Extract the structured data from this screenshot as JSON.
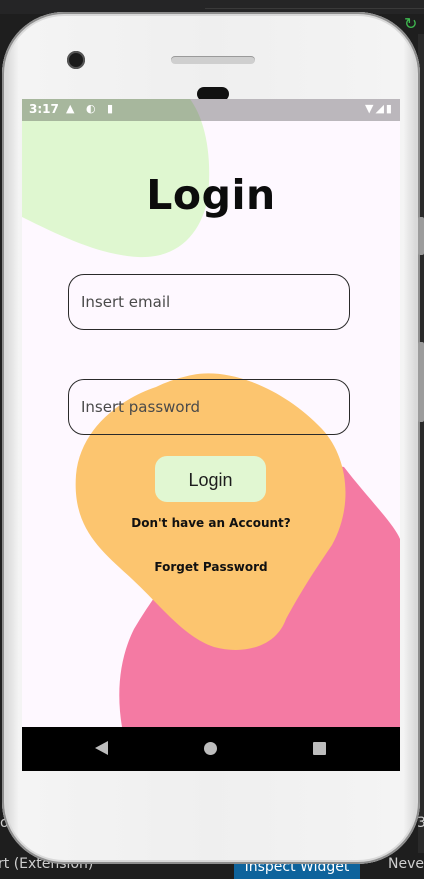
{
  "ide": {
    "extension_label": "rt (Extension)",
    "inspect_label": "Inspect Widget",
    "never_label": "Never",
    "left_fragment": "o",
    "right_fragment": "3",
    "refresh_icon": "refresh-icon"
  },
  "device": {
    "status_bar": {
      "time": "3:17",
      "left_icons": "▲ ◐ ▮",
      "right_icons": "▼◢▮"
    }
  },
  "login": {
    "title": "Login",
    "email_placeholder": "Insert email",
    "password_placeholder": "Insert password",
    "login_button": "Login",
    "signup_link": "Don't have an Account?",
    "forgot_link": "Forget Password"
  },
  "colors": {
    "blob_green": "#dff7d0",
    "blob_orange": "#fcc56f",
    "blob_pink": "#f47aa3",
    "screen_bg": "#fef8ff",
    "button_bg": "#e1f7d2"
  }
}
